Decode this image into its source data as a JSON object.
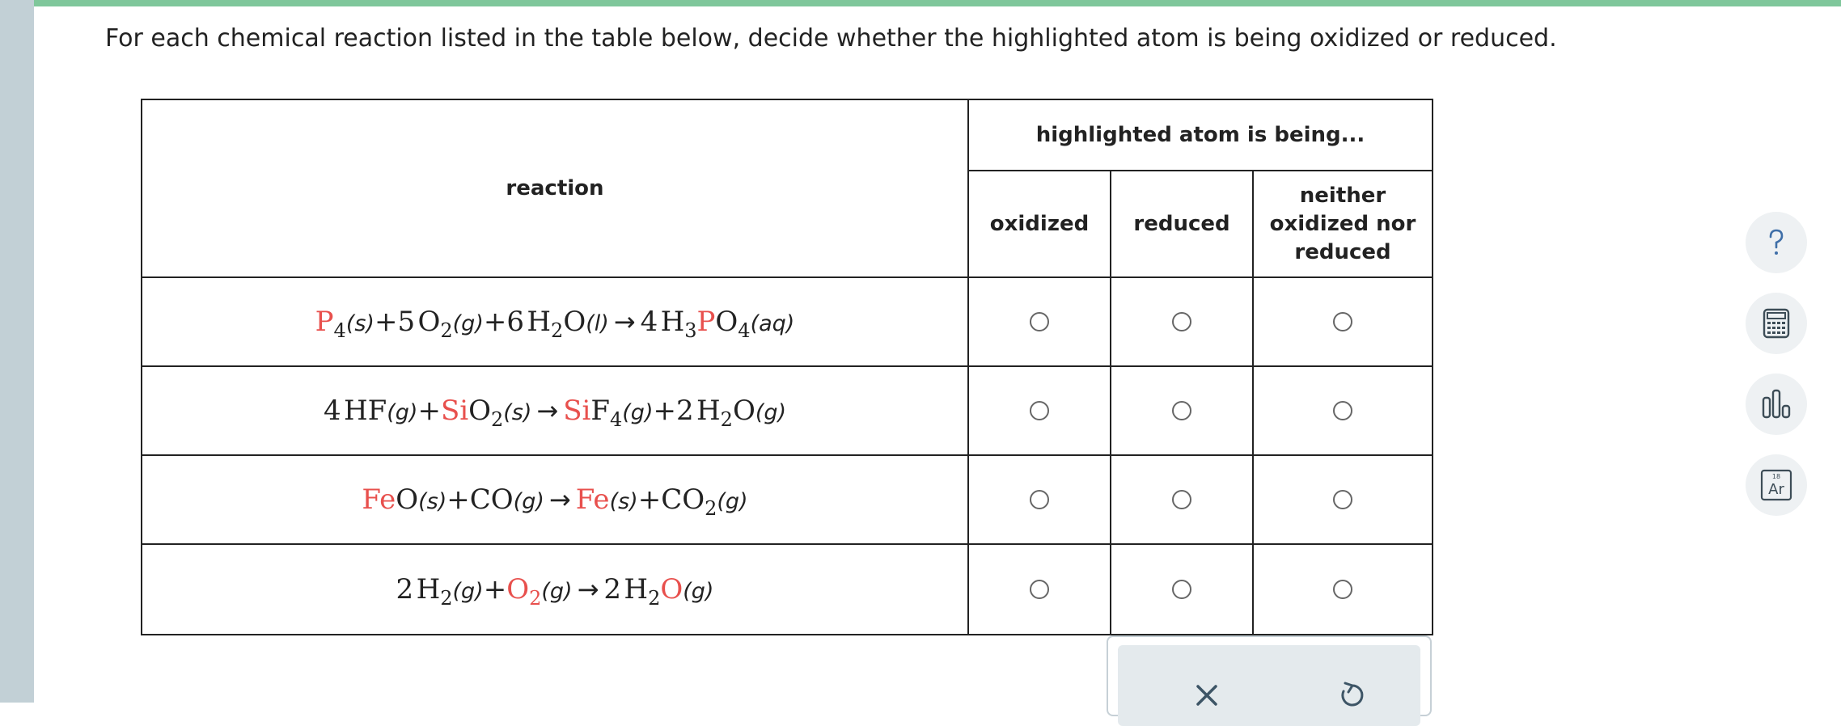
{
  "prompt": "For each chemical reaction listed in the table below, decide whether the highlighted atom is being oxidized or reduced.",
  "table": {
    "reaction_header": "reaction",
    "group_header": "highlighted atom is being...",
    "options": [
      "oxidized",
      "reduced",
      "neither oxidized nor reduced"
    ],
    "rows": [
      {
        "id": "r1",
        "equation": "P4(s)+5O2(g)+6H2O(l) → 4H3PO4(aq)",
        "highlighted_atom": "P",
        "selected": null
      },
      {
        "id": "r2",
        "equation": "4HF(g)+SiO2(s) → SiF4(g)+2H2O(g)",
        "highlighted_atom": "Si",
        "selected": null
      },
      {
        "id": "r3",
        "equation": "FeO(s)+CO(g) → Fe(s)+CO2(g)",
        "highlighted_atom": "Fe",
        "selected": null
      },
      {
        "id": "r4",
        "equation": "2H2(g)+O2(g) → 2H2O(g)",
        "highlighted_atom": "O",
        "selected": null
      }
    ]
  },
  "icons": {
    "help": "help-question-icon",
    "calculator": "calculator-icon",
    "chart": "bar-chart-icon",
    "periodic_table": "periodic-table-icon",
    "periodic_number": "18",
    "periodic_symbol": "Ar",
    "clear": "close-x-icon",
    "reset": "undo-icon"
  },
  "colors": {
    "highlight": "#e8504d",
    "top_bar": "#7fc79b",
    "left_rail": "#c2d0d6",
    "panel": "#e4eaed"
  }
}
